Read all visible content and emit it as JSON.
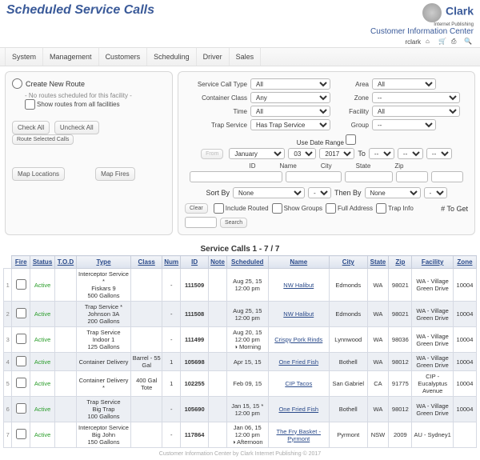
{
  "header": {
    "title": "Scheduled Service Calls",
    "brand_name": "Clark",
    "brand_sub": "Internet Publishing",
    "cic": "Customer Information Center",
    "user": "rclark"
  },
  "nav": [
    "System",
    "Management",
    "Customers",
    "Scheduling",
    "Driver",
    "Sales"
  ],
  "left": {
    "create": "Create New Route",
    "noroutes": "- No routes scheduled for this facility -",
    "showall": "Show routes from all facilities",
    "check_all": "Check All",
    "uncheck_all": "Uncheck All",
    "route_selected": "Route Selected Calls",
    "map_locations": "Map Locations",
    "map_fires": "Map Fires"
  },
  "filters": {
    "labels": {
      "type": "Service Call Type",
      "container": "Container Class",
      "time": "Time",
      "trap": "Trap Service",
      "area": "Area",
      "zone": "Zone",
      "facility": "Facility",
      "group": "Group"
    },
    "values": {
      "type": "All",
      "container": "Any",
      "time": "All",
      "trap": "Has Trap Service",
      "area": "All",
      "zone": "--",
      "facility": "All",
      "group": "--"
    },
    "daterange": "Use Date Range",
    "from": "From",
    "to": "To",
    "month": "January",
    "day": "03",
    "year": "2017",
    "dash": "--",
    "cols": {
      "id": "ID",
      "name": "Name",
      "city": "City",
      "state": "State",
      "zip": "Zip"
    },
    "sortby": "Sort By",
    "thenby": "Then By",
    "none": "None",
    "minus": "-",
    "clear": "Clear",
    "routed": "Include Routed",
    "groups": "Show Groups",
    "full": "Full Address",
    "trapinfo": "Trap Info",
    "toget": "# To Get",
    "search": "Search"
  },
  "table": {
    "title": "Service Calls 1 - 7 / 7",
    "headers": [
      "Fire",
      "Status",
      "T.O.D",
      "Type",
      "Class",
      "Num",
      "ID",
      "Note",
      "Scheduled",
      "Name",
      "City",
      "State",
      "Zip",
      "Facility",
      "Zone"
    ],
    "rows": [
      {
        "n": "1",
        "status": "Active",
        "type": "Interceptor Service *\nFiskars 9\n500 Gallons",
        "class": "",
        "num": "-",
        "id": "111509",
        "sched": "Aug 25, 15\n12:00 pm",
        "name": "NW Halibut",
        "city": "Edmonds",
        "state": "WA",
        "zip": "98021",
        "facility": "WA - Village Green Drive",
        "zone": "10004"
      },
      {
        "n": "2",
        "status": "Active",
        "type": "Trap Service    *\nJohnson 3A\n200 Gallons",
        "class": "",
        "num": "-",
        "id": "111508",
        "sched": "Aug 25, 15\n12:00 pm",
        "name": "NW Halibut",
        "city": "Edmonds",
        "state": "WA",
        "zip": "98021",
        "facility": "WA - Village Green Drive",
        "zone": "10004"
      },
      {
        "n": "3",
        "status": "Active",
        "type": "Trap Service\nIndoor 1\n125 Gallons",
        "class": "",
        "num": "-",
        "id": "111499",
        "sched": "Aug 20, 15\n12:00 pm\n◑ Morning",
        "name": "Crispy Pork Rinds",
        "city": "Lynnwood",
        "state": "WA",
        "zip": "98036",
        "facility": "WA - Village Green Drive",
        "zone": "10004"
      },
      {
        "n": "4",
        "status": "Active",
        "type": "Container Delivery",
        "class": "Barrel - 55 Gal",
        "num": "1",
        "id": "105698",
        "sched": "Apr 15, 15",
        "name": "One Fried Fish",
        "city": "Bothell",
        "state": "WA",
        "zip": "98012",
        "facility": "WA - Village Green Drive",
        "zone": "10004"
      },
      {
        "n": "5",
        "status": "Active",
        "type": "Container Delivery *",
        "class": "400 Gal Tote",
        "num": "1",
        "id": "102255",
        "sched": "Feb 09, 15",
        "name": "CIP Tacos",
        "city": "San Gabriel",
        "state": "CA",
        "zip": "91775",
        "facility": "CIP - Eucalyptus Avenue",
        "zone": "10004"
      },
      {
        "n": "6",
        "status": "Active",
        "type": "Trap Service\nBig Trap\n100 Gallons",
        "class": "",
        "num": "-",
        "id": "105690",
        "sched": "Jan 15, 15 *\n12:00 pm",
        "name": "One Fried Fish",
        "city": "Bothell",
        "state": "WA",
        "zip": "98012",
        "facility": "WA - Village Green Drive",
        "zone": "10004"
      },
      {
        "n": "7",
        "status": "Active",
        "type": "Interceptor Service\nBig John\n150 Gallons",
        "class": "",
        "num": "-",
        "id": "117864",
        "sched": "Jan 06, 15\n12:00 pm\n◑ Afternoon",
        "name": "The Fry Basket - Pyrmont",
        "city": "Pyrmont",
        "state": "NSW",
        "zip": "2009",
        "facility": "AU - Sydney1",
        "zone": ""
      }
    ]
  },
  "footer": "Customer Information Center by Clark Internet Publishing © 2017"
}
